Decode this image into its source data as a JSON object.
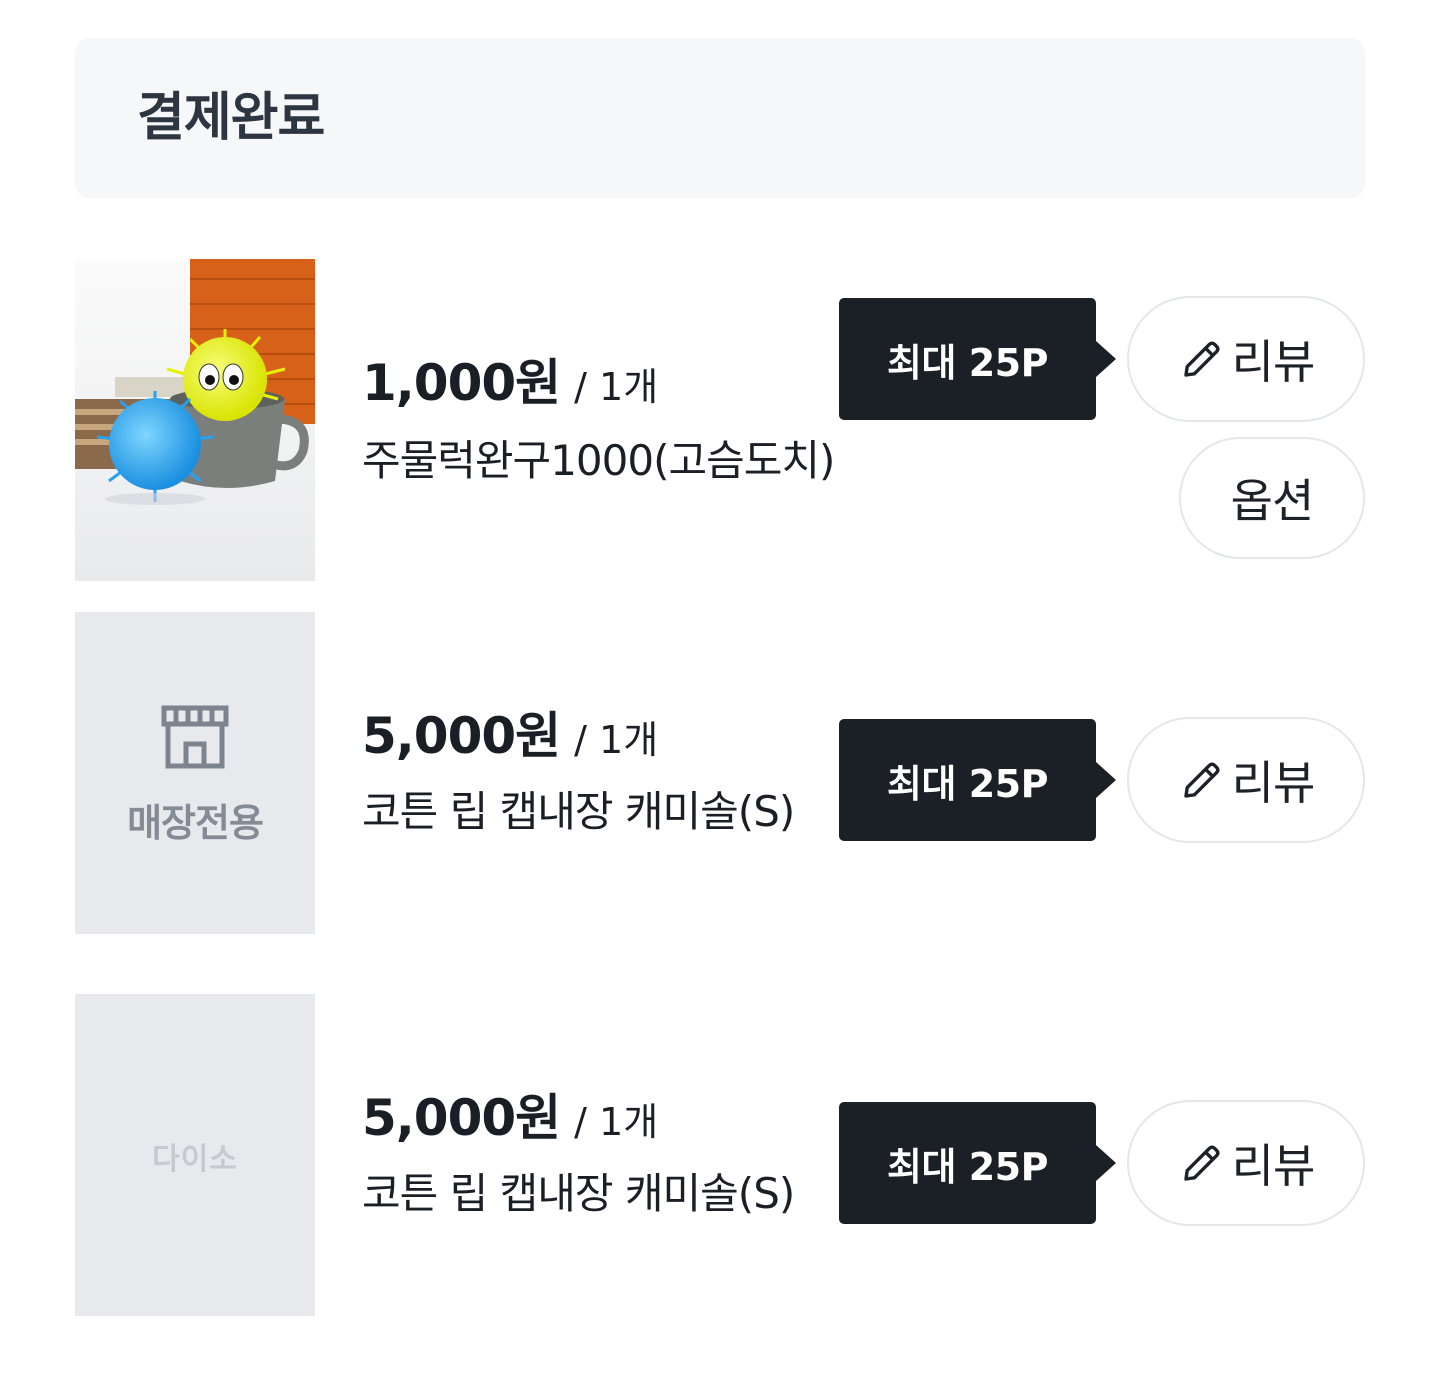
{
  "header": {
    "status": "결제완료"
  },
  "items": [
    {
      "price": "1,000원",
      "qty": "/ 1개",
      "name": "주물럭완구1000(고슴도치)",
      "tooltip": "최대 25P",
      "review_label": "리뷰",
      "option_label": "옵션"
    },
    {
      "price": "5,000원",
      "qty": "/ 1개",
      "name": "코튼 립 캡내장 캐미솔(S)",
      "tooltip": "최대 25P",
      "review_label": "리뷰",
      "thumb_label": "매장전용"
    },
    {
      "price": "5,000원",
      "qty": "/ 1개",
      "name": "코튼 립 캡내장 캐미솔(S)",
      "tooltip": "최대 25P",
      "review_label": "리뷰",
      "thumb_label": "다이소"
    }
  ]
}
